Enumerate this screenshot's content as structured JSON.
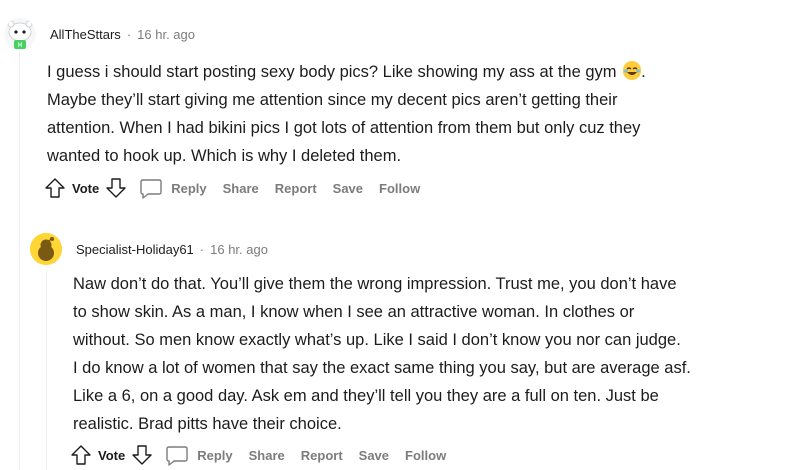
{
  "comments": [
    {
      "username": "AllTheSttars",
      "separator": "·",
      "time": "16 hr. ago",
      "lines": [
        "I guess i should start posting sexy body pics? Like showing my ass at the gym",
        "Maybe they’ll start giving me attention since my decent pics aren’t getting their",
        "attention. When I had bikini pics I got lots of attention from them but only cuz they",
        "wanted to hook up. Which is why I deleted them."
      ],
      "line1_suffix": ".",
      "emoji_icon": "laughing-face-icon",
      "actions": {
        "vote": "Vote",
        "reply": "Reply",
        "share": "Share",
        "report": "Report",
        "save": "Save",
        "follow": "Follow"
      }
    },
    {
      "username": "Specialist-Holiday61",
      "separator": "·",
      "time": "16 hr. ago",
      "lines": [
        "Naw don’t do that. You’ll give them the wrong impression. Trust me, you don’t have",
        "to show skin. As a man, I know when I see an attractive woman. In clothes or",
        "without. So men know exactly what’s up. Like I said I don’t know you nor can judge.",
        "I do know a lot of women that say the exact same thing you say, but are average asf.",
        "Like a 6, on a good day. Ask em and they’ll tell you they are a full on ten. Just be",
        "realistic. Brad pitts have their choice."
      ],
      "actions": {
        "vote": "Vote",
        "reply": "Reply",
        "share": "Share",
        "report": "Report",
        "save": "Save",
        "follow": "Follow"
      }
    }
  ],
  "colors": {
    "text": "#1c1c1c",
    "meta": "#7c7c7c",
    "thread_line": "#edeff1",
    "avatar2_bg": "#ffd635"
  }
}
